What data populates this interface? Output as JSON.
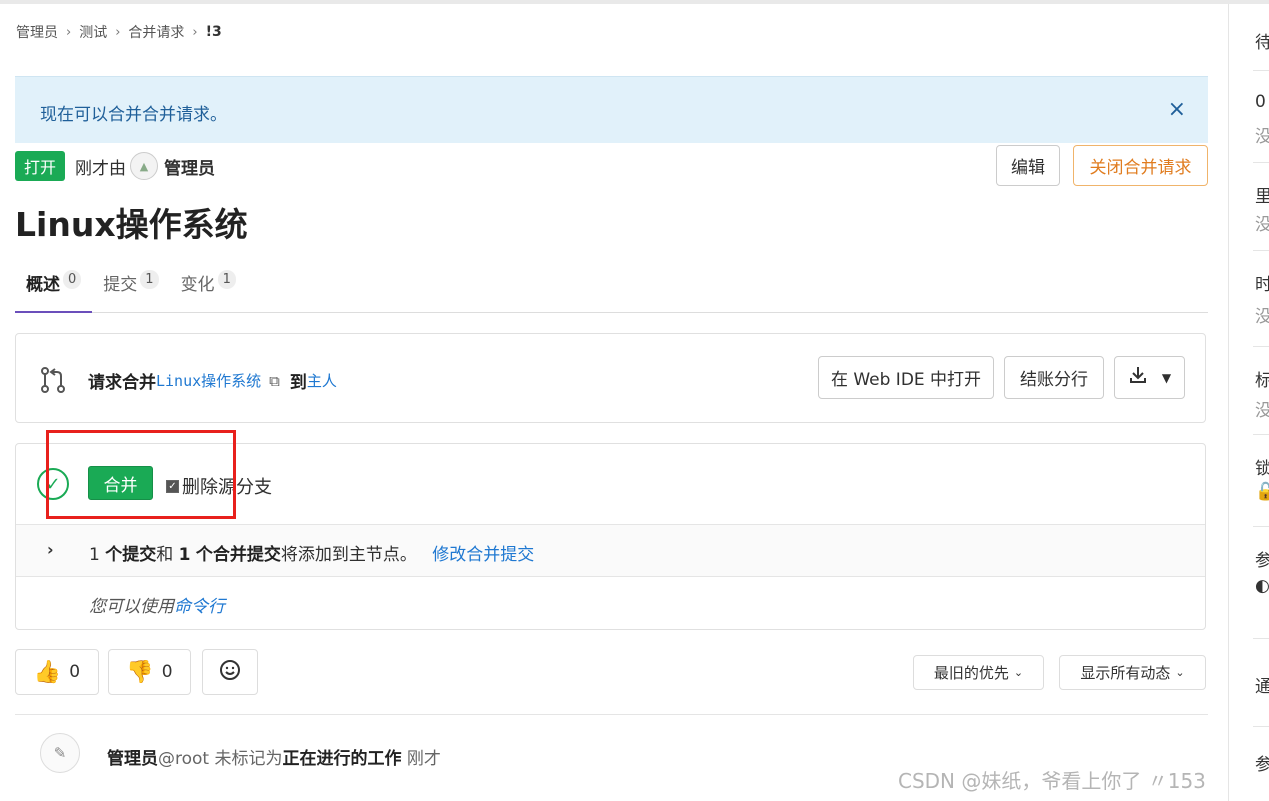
{
  "breadcrumb": [
    "管理员",
    "测试",
    "合并请求",
    "!3"
  ],
  "alert": {
    "message": "现在可以合并合并请求。",
    "close": "×"
  },
  "header": {
    "status": "打开",
    "created_prefix": "刚才由",
    "author": "管理员",
    "edit_label": "编辑",
    "close_label": "关闭合并请求"
  },
  "title": "Linux操作系统",
  "tabs": [
    {
      "label": "概述",
      "count": "0"
    },
    {
      "label": "提交",
      "count": "1"
    },
    {
      "label": "变化",
      "count": "1"
    }
  ],
  "widget": {
    "request_label": "请求合并",
    "source_branch": "Linux操作系统",
    "to_label": "到",
    "target_branch": "主人",
    "web_ide_label": "在 Web IDE 中打开",
    "checkout_label": "结账分行"
  },
  "merge": {
    "merge_label": "合并",
    "delete_source_label": "删除源分支",
    "commit_count": "1",
    "commit_word": "个提交",
    "and_word": "和",
    "merge_commit_count": "1",
    "merge_commit_word": "个合并提交",
    "tail_text": "将添加到主节点。",
    "modify_link": "修改合并提交",
    "cmd_prefix": "您可以使用",
    "cmd_link": "命令行"
  },
  "reactions": {
    "thumbs_up": "0",
    "thumbs_down": "0"
  },
  "sort_label": "最旧的优先",
  "filter_label": "显示所有动态",
  "activity": {
    "author": "管理员",
    "handle": "@root",
    "text": "未标记为",
    "emph": "正在进行的工作",
    "time": "刚才"
  },
  "watermark": "CSDN @妹纸，爷看上你了 〃153",
  "sidebar": [
    "待",
    "0",
    "没",
    "里",
    "没",
    "时",
    "没",
    "标",
    "没",
    "锁",
    "参",
    "通",
    "参"
  ],
  "colors": {
    "accent_green": "#1aaa55",
    "alert_bg": "#e1f1fa",
    "link_blue": "#1f78d1",
    "close_orange": "#e07c1f",
    "highlight_red": "#e8201c"
  }
}
